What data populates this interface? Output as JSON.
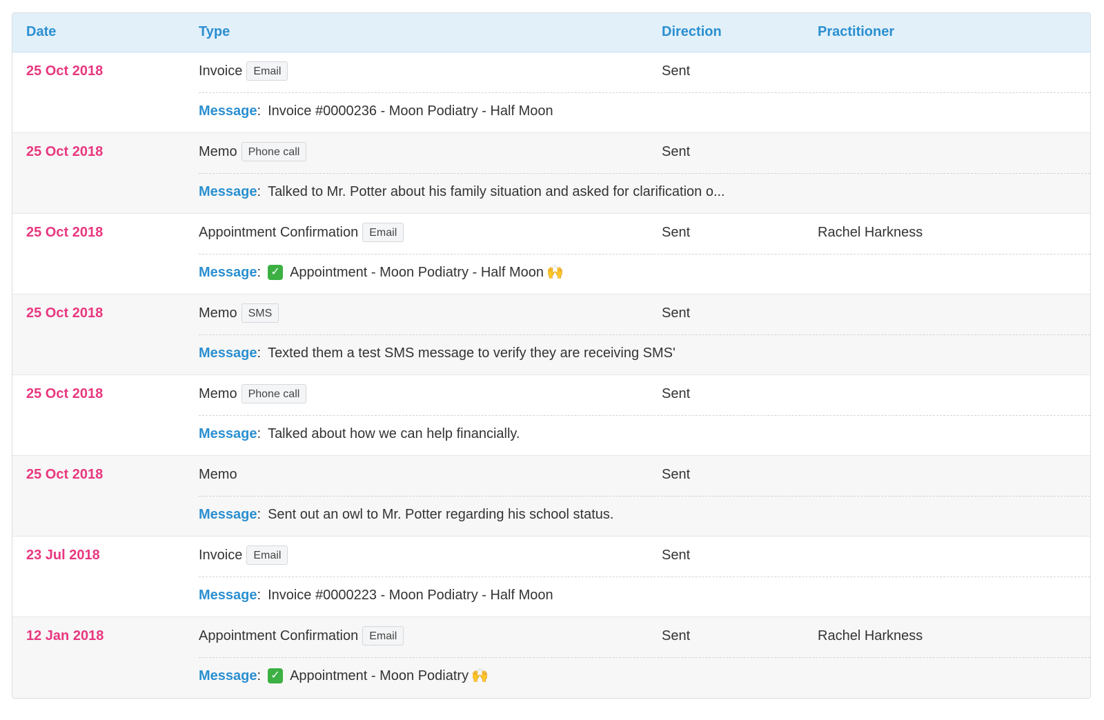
{
  "header": {
    "date": "Date",
    "type": "Type",
    "direction": "Direction",
    "practitioner": "Practitioner"
  },
  "message_label": "Message",
  "rows": [
    {
      "date": "25 Oct 2018",
      "type": "Invoice",
      "tag": "Email",
      "direction": "Sent",
      "practitioner": "",
      "message": "Invoice #0000236 - Moon Podiatry - Half Moon",
      "check_icon": false,
      "hands_icon": false
    },
    {
      "date": "25 Oct 2018",
      "type": "Memo",
      "tag": "Phone call",
      "direction": "Sent",
      "practitioner": "",
      "message": "Talked to Mr. Potter about his family situation and asked for clarification o...",
      "check_icon": false,
      "hands_icon": false
    },
    {
      "date": "25 Oct 2018",
      "type": "Appointment Confirmation",
      "tag": "Email",
      "direction": "Sent",
      "practitioner": "Rachel Harkness",
      "message": "Appointment - Moon Podiatry - Half Moon",
      "check_icon": true,
      "hands_icon": true
    },
    {
      "date": "25 Oct 2018",
      "type": "Memo",
      "tag": "SMS",
      "direction": "Sent",
      "practitioner": "",
      "message": "Texted them a test SMS message to verify they are receiving SMS'",
      "check_icon": false,
      "hands_icon": false
    },
    {
      "date": "25 Oct 2018",
      "type": "Memo",
      "tag": "Phone call",
      "direction": "Sent",
      "practitioner": "",
      "message": "Talked about how we can help financially.",
      "check_icon": false,
      "hands_icon": false
    },
    {
      "date": "25 Oct 2018",
      "type": "Memo",
      "tag": "",
      "direction": "Sent",
      "practitioner": "",
      "message": "Sent out an owl to Mr. Potter regarding his school status.",
      "check_icon": false,
      "hands_icon": false
    },
    {
      "date": "23 Jul 2018",
      "type": "Invoice",
      "tag": "Email",
      "direction": "Sent",
      "practitioner": "",
      "message": "Invoice #0000223 - Moon Podiatry - Half Moon",
      "check_icon": false,
      "hands_icon": false
    },
    {
      "date": "12 Jan 2018",
      "type": "Appointment Confirmation",
      "tag": "Email",
      "direction": "Sent",
      "practitioner": "Rachel Harkness",
      "message": "Appointment - Moon Podiatry",
      "check_icon": true,
      "hands_icon": true
    }
  ]
}
